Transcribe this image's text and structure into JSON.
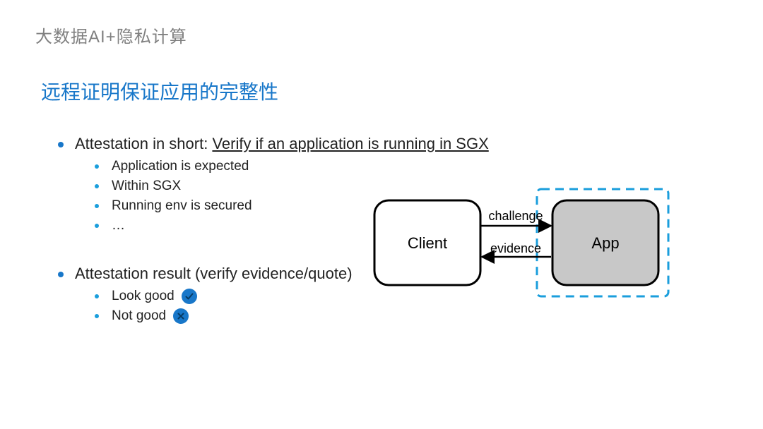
{
  "supertitle": "大数据AI+隐私计算",
  "title": "远程证明保证应用的完整性",
  "bullet1": {
    "prefix": "Attestation in short: ",
    "underlined": "Verify if an application is running in SGX"
  },
  "sub1": {
    "a": "Application is expected",
    "b": "Within SGX",
    "c": "Running env is secured",
    "d": "…"
  },
  "bullet2": "Attestation result (verify evidence/quote)",
  "sub2": {
    "a": "Look good",
    "b": "Not good"
  },
  "diagram": {
    "client": "Client",
    "app": "App",
    "challenge": "challenge",
    "evidence": "evidence"
  }
}
